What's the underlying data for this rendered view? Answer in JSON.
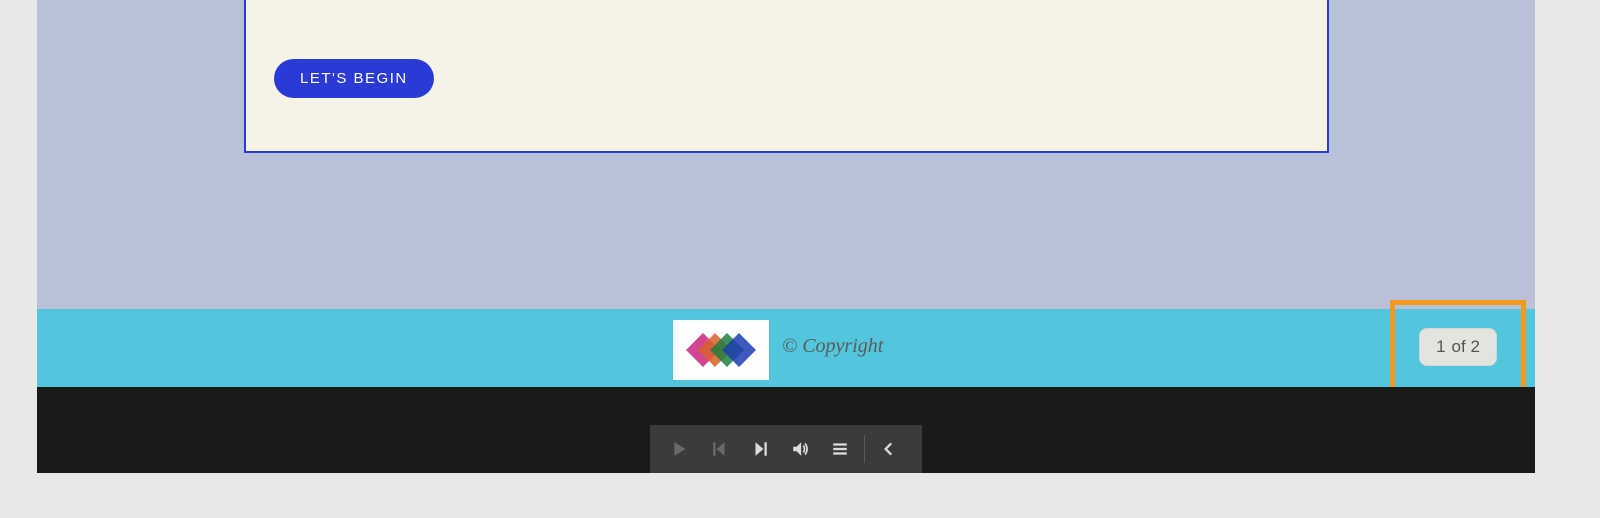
{
  "content": {
    "begin_label": "LET'S BEGIN"
  },
  "footer": {
    "copyright": "© Copyright"
  },
  "paging": {
    "current": "1",
    "of_label": "of 2"
  },
  "colors": {
    "teal": "#52c6dd",
    "primary_blue": "#2a3ad4",
    "highlight_orange": "#f39a1e"
  }
}
